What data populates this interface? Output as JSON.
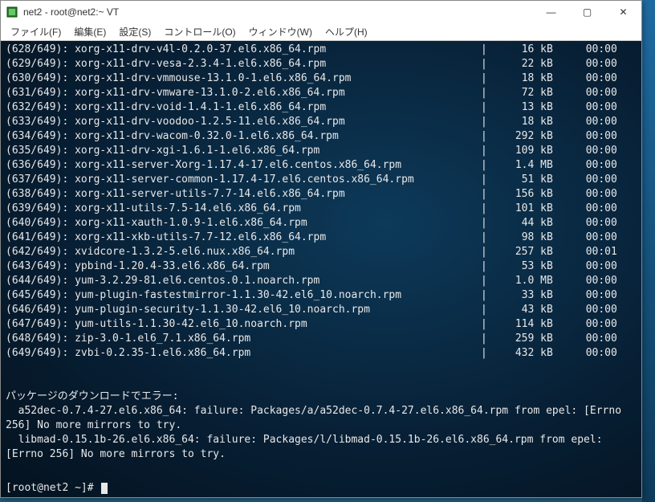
{
  "titlebar": {
    "text": "net2 - root@net2:~ VT"
  },
  "menubar": {
    "items": [
      "ファイル(F)",
      "編集(E)",
      "設定(S)",
      "コントロール(O)",
      "ウィンドウ(W)",
      "ヘルプ(H)"
    ]
  },
  "terminal": {
    "rows": [
      {
        "idx": "(628/649):",
        "name": "xorg-x11-drv-v4l-0.2.0-37.el6.x86_64.rpm",
        "size": "16 kB",
        "time": "00:00"
      },
      {
        "idx": "(629/649):",
        "name": "xorg-x11-drv-vesa-2.3.4-1.el6.x86_64.rpm",
        "size": "22 kB",
        "time": "00:00"
      },
      {
        "idx": "(630/649):",
        "name": "xorg-x11-drv-vmmouse-13.1.0-1.el6.x86_64.rpm",
        "size": "18 kB",
        "time": "00:00"
      },
      {
        "idx": "(631/649):",
        "name": "xorg-x11-drv-vmware-13.1.0-2.el6.x86_64.rpm",
        "size": "72 kB",
        "time": "00:00"
      },
      {
        "idx": "(632/649):",
        "name": "xorg-x11-drv-void-1.4.1-1.el6.x86_64.rpm",
        "size": "13 kB",
        "time": "00:00"
      },
      {
        "idx": "(633/649):",
        "name": "xorg-x11-drv-voodoo-1.2.5-11.el6.x86_64.rpm",
        "size": "18 kB",
        "time": "00:00"
      },
      {
        "idx": "(634/649):",
        "name": "xorg-x11-drv-wacom-0.32.0-1.el6.x86_64.rpm",
        "size": "292 kB",
        "time": "00:00"
      },
      {
        "idx": "(635/649):",
        "name": "xorg-x11-drv-xgi-1.6.1-1.el6.x86_64.rpm",
        "size": "109 kB",
        "time": "00:00"
      },
      {
        "idx": "(636/649):",
        "name": "xorg-x11-server-Xorg-1.17.4-17.el6.centos.x86_64.rpm",
        "size": "1.4 MB",
        "time": "00:00"
      },
      {
        "idx": "(637/649):",
        "name": "xorg-x11-server-common-1.17.4-17.el6.centos.x86_64.rpm",
        "size": "51 kB",
        "time": "00:00"
      },
      {
        "idx": "(638/649):",
        "name": "xorg-x11-server-utils-7.7-14.el6.x86_64.rpm",
        "size": "156 kB",
        "time": "00:00"
      },
      {
        "idx": "(639/649):",
        "name": "xorg-x11-utils-7.5-14.el6.x86_64.rpm",
        "size": "101 kB",
        "time": "00:00"
      },
      {
        "idx": "(640/649):",
        "name": "xorg-x11-xauth-1.0.9-1.el6.x86_64.rpm",
        "size": "44 kB",
        "time": "00:00"
      },
      {
        "idx": "(641/649):",
        "name": "xorg-x11-xkb-utils-7.7-12.el6.x86_64.rpm",
        "size": "98 kB",
        "time": "00:00"
      },
      {
        "idx": "(642/649):",
        "name": "xvidcore-1.3.2-5.el6.nux.x86_64.rpm",
        "size": "257 kB",
        "time": "00:01"
      },
      {
        "idx": "(643/649):",
        "name": "ypbind-1.20.4-33.el6.x86_64.rpm",
        "size": "53 kB",
        "time": "00:00"
      },
      {
        "idx": "(644/649):",
        "name": "yum-3.2.29-81.el6.centos.0.1.noarch.rpm",
        "size": "1.0 MB",
        "time": "00:00"
      },
      {
        "idx": "(645/649):",
        "name": "yum-plugin-fastestmirror-1.1.30-42.el6_10.noarch.rpm",
        "size": "33 kB",
        "time": "00:00"
      },
      {
        "idx": "(646/649):",
        "name": "yum-plugin-security-1.1.30-42.el6_10.noarch.rpm",
        "size": "43 kB",
        "time": "00:00"
      },
      {
        "idx": "(647/649):",
        "name": "yum-utils-1.1.30-42.el6_10.noarch.rpm",
        "size": "114 kB",
        "time": "00:00"
      },
      {
        "idx": "(648/649):",
        "name": "zip-3.0-1.el6_7.1.x86_64.rpm",
        "size": "259 kB",
        "time": "00:00"
      },
      {
        "idx": "(649/649):",
        "name": "zvbi-0.2.35-1.el6.x86_64.rpm",
        "size": "432 kB",
        "time": "00:00"
      }
    ],
    "error_header": "パッケージのダウンロードでエラー:",
    "error_line1": "  a52dec-0.7.4-27.el6.x86_64: failure: Packages/a/a52dec-0.7.4-27.el6.x86_64.rpm from epel: [Errno 256] No more mirrors to try.",
    "error_line2": "  libmad-0.15.1b-26.el6.x86_64: failure: Packages/l/libmad-0.15.1b-26.el6.x86_64.rpm from epel: [Errno 256] No more mirrors to try.",
    "prompt": "[root@net2 ~]# "
  }
}
